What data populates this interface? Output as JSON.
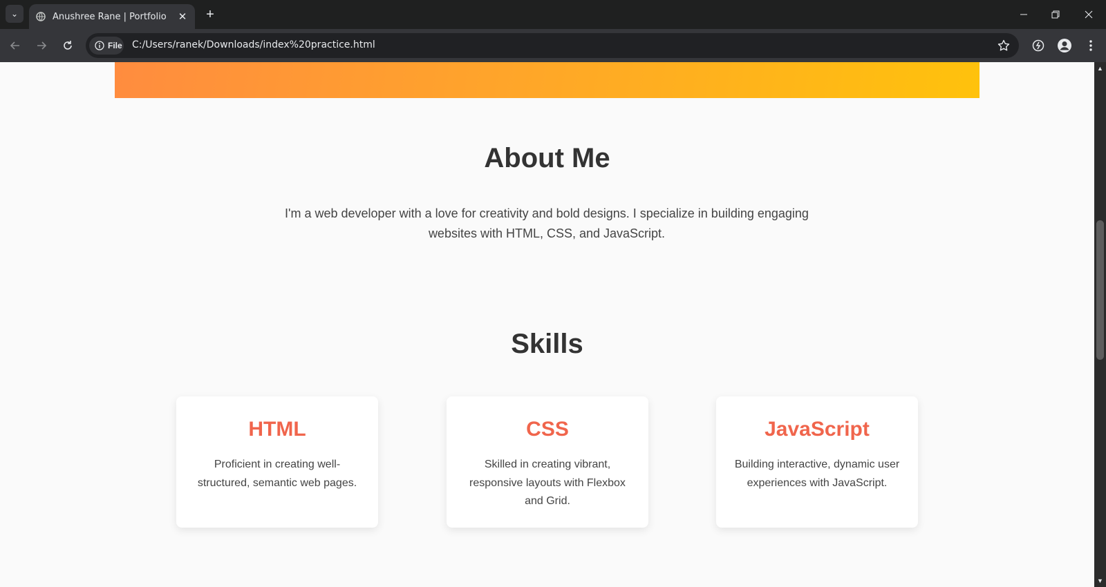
{
  "browser": {
    "tab_title": "Anushree Rane | Portfolio",
    "chip_label": "File",
    "url": "C:/Users/ranek/Downloads/index%20practice.html"
  },
  "page": {
    "about": {
      "heading": "About Me",
      "text": "I'm a web developer with a love for creativity and bold designs. I specialize in building engaging websites with HTML, CSS, and JavaScript."
    },
    "skills": {
      "heading": "Skills",
      "cards": [
        {
          "title": "HTML",
          "desc": "Proficient in creating well-structured, semantic web pages."
        },
        {
          "title": "CSS",
          "desc": "Skilled in creating vibrant, responsive layouts with Flexbox and Grid."
        },
        {
          "title": "JavaScript",
          "desc": "Building interactive, dynamic user experiences with JavaScript."
        }
      ]
    }
  },
  "colors": {
    "accent": "#f0654c",
    "gradient_start": "#ff8c3f",
    "gradient_end": "#ffc20c"
  }
}
